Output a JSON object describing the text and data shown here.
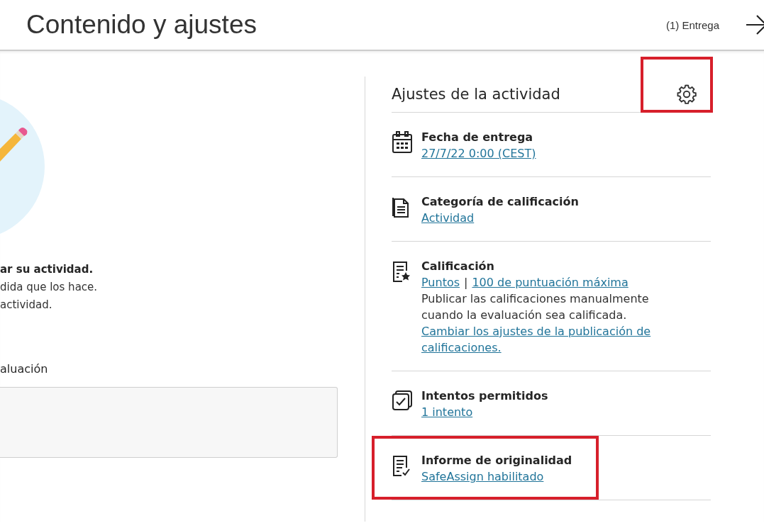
{
  "header": {
    "title": "Contenido y ajustes",
    "submissions": "(1) Entrega"
  },
  "left": {
    "heading": "ar su actividad.",
    "lines": [
      "dida que los hace.",
      "actividad."
    ],
    "field_label": "aluación"
  },
  "settings": {
    "title": "Ajustes de la actividad",
    "gear_highlighted": true,
    "items": [
      {
        "kind": "date",
        "title": "Fecha de entrega",
        "highlighted": false,
        "lines": [
          [
            {
              "kind": "link",
              "text": "27/7/22 0:00 (CEST)"
            }
          ]
        ]
      },
      {
        "kind": "category",
        "title": "Categoría de calificación",
        "highlighted": false,
        "lines": [
          [
            {
              "kind": "link",
              "text": "Actividad"
            }
          ]
        ]
      },
      {
        "kind": "grade",
        "title": "Calificación",
        "highlighted": false,
        "lines": [
          [
            {
              "kind": "link",
              "text": "Puntos"
            },
            {
              "kind": "sep",
              "text": "|"
            },
            {
              "kind": "link",
              "text": "100 de puntuación máxima"
            }
          ],
          [
            {
              "kind": "text",
              "text": "Publicar las calificaciones manualmente cuando la evaluación sea calificada."
            }
          ],
          [
            {
              "kind": "link",
              "text": "Cambiar los ajustes de la publicación de calificaciones."
            }
          ]
        ]
      },
      {
        "kind": "attempts",
        "title": "Intentos permitidos",
        "highlighted": false,
        "lines": [
          [
            {
              "kind": "link",
              "text": "1 intento"
            }
          ]
        ]
      },
      {
        "kind": "originality",
        "title": "Informe de originalidad",
        "highlighted": true,
        "lines": [
          [
            {
              "kind": "link",
              "text": "SafeAssign habilitado"
            }
          ]
        ]
      }
    ]
  }
}
